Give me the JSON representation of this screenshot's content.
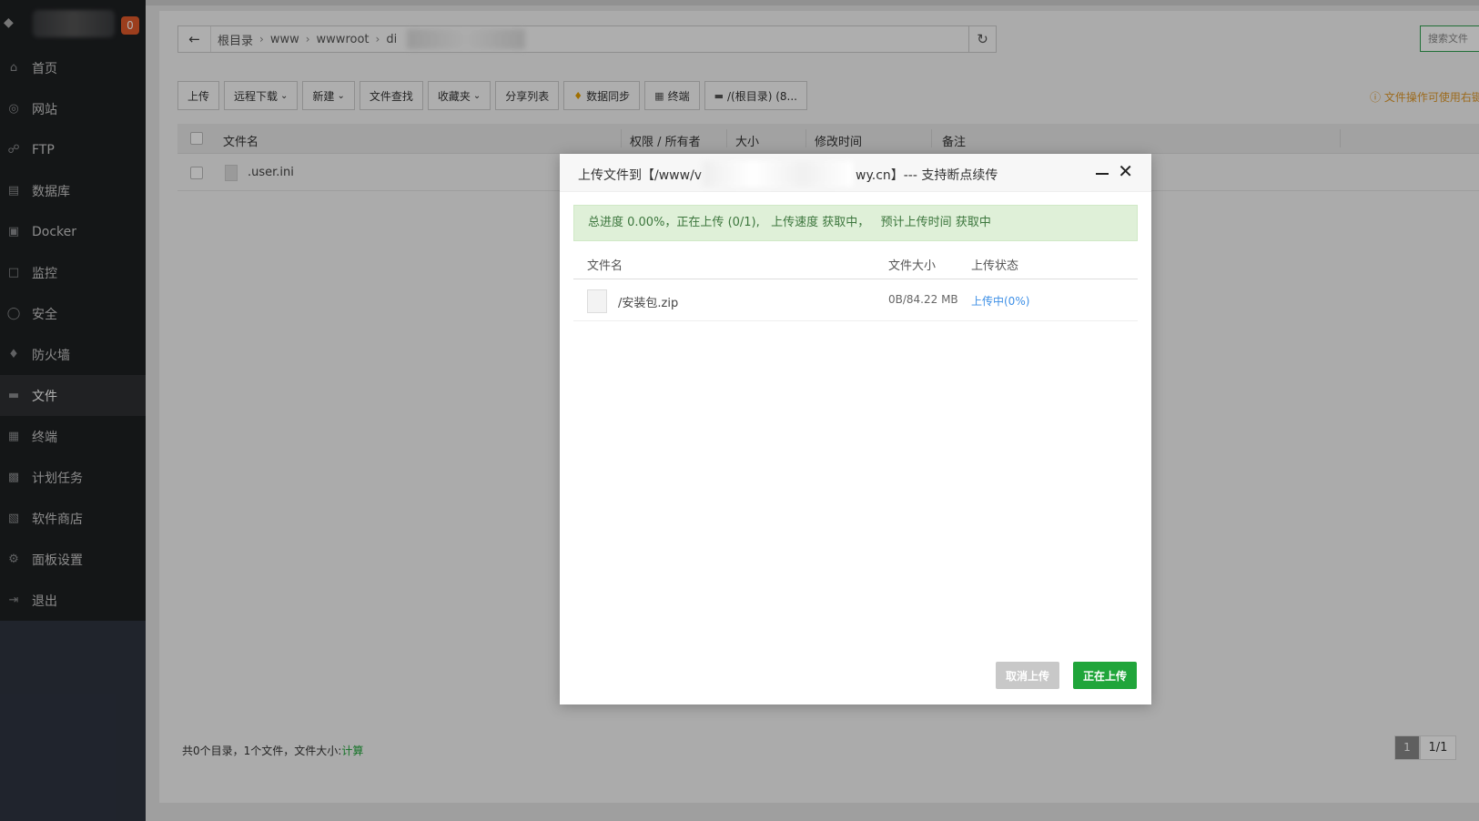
{
  "sidebar": {
    "badge": "0",
    "items": [
      {
        "label": "首页",
        "icon": "home-icon"
      },
      {
        "label": "网站",
        "icon": "globe-icon"
      },
      {
        "label": "FTP",
        "icon": "ftp-icon"
      },
      {
        "label": "数据库",
        "icon": "database-icon"
      },
      {
        "label": "Docker",
        "icon": "docker-icon"
      },
      {
        "label": "监控",
        "icon": "monitor-icon"
      },
      {
        "label": "安全",
        "icon": "shield-icon"
      },
      {
        "label": "防火墙",
        "icon": "firewall-icon"
      },
      {
        "label": "文件",
        "icon": "folder-icon",
        "active": true
      },
      {
        "label": "终端",
        "icon": "terminal-icon"
      },
      {
        "label": "计划任务",
        "icon": "calendar-icon"
      },
      {
        "label": "软件商店",
        "icon": "apps-icon"
      },
      {
        "label": "面板设置",
        "icon": "gear-icon"
      },
      {
        "label": "退出",
        "icon": "logout-icon"
      }
    ]
  },
  "path": {
    "crumbs": [
      "根目录",
      "www",
      "wwwroot",
      "di"
    ]
  },
  "search": {
    "placeholder": "搜索文件"
  },
  "toolbar": {
    "upload": "上传",
    "remote_download": "远程下载",
    "new": "新建",
    "find": "文件查找",
    "favorites": "收藏夹",
    "share_list": "分享列表",
    "sync": "数据同步",
    "terminal": "终端",
    "disk": "/(根目录) (8..."
  },
  "tip": "文件操作可使用右键",
  "table": {
    "headers": [
      "文件名",
      "权限 / 所有者",
      "大小",
      "修改时间",
      "备注"
    ],
    "rows": [
      {
        "name": ".user.ini"
      }
    ]
  },
  "footer": {
    "summary": "共0个目录，1个文件，文件大小:",
    "calc": "计算",
    "page": "1",
    "total": "1/1"
  },
  "modal": {
    "title_prefix": "上传文件到【/www/v",
    "title_suffix": "wy.cn】--- 支持断点续传",
    "progress": "总进度 0.00%，正在上传 (0/1),   上传速度 获取中，   预计上传时间 获取中",
    "headers": [
      "文件名",
      "文件大小",
      "上传状态"
    ],
    "file": {
      "name": "/安装包.zip",
      "size": "0B/84.22 MB",
      "status": "上传中(0%)"
    },
    "cancel_label": "取消上传",
    "upload_label": "正在上传"
  },
  "colors": {
    "accent": "#20a53a",
    "status_link": "#3d8fe6",
    "badge": "#e05a2a"
  }
}
